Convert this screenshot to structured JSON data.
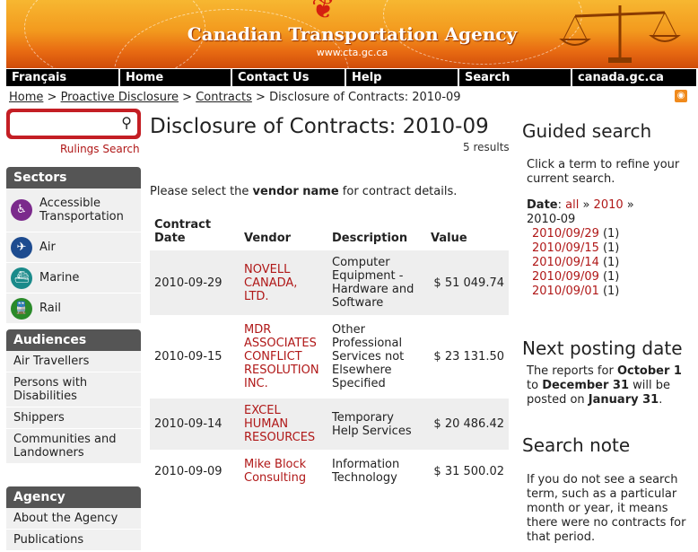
{
  "header": {
    "title": "Canadian Transportation Agency",
    "url": "www.cta.gc.ca"
  },
  "nav": [
    {
      "label": "Français",
      "w": 127
    },
    {
      "label": "Home",
      "w": 125
    },
    {
      "label": "Contact Us",
      "w": 127
    },
    {
      "label": "Help",
      "w": 126
    },
    {
      "label": "Search",
      "w": 126
    },
    {
      "label": "canada.gc.ca",
      "w": 140
    }
  ],
  "breadcrumb": {
    "home": "Home",
    "sep1": " > ",
    "proactive": "Proactive Disclosure",
    "sep2": " > ",
    "contracts": "Contracts",
    "sep3": " > ",
    "current": "Disclosure of Contracts: 2010-09"
  },
  "search": {
    "placeholder": "",
    "rulings": "Rulings Search"
  },
  "sectors": {
    "heading": "Sectors",
    "items": [
      {
        "label": "Accessible Transportation",
        "icon": "wheelchair-icon",
        "color": "#7b2a8c",
        "glyph": "♿"
      },
      {
        "label": "Air",
        "icon": "airplane-icon",
        "color": "#1d4b8f",
        "glyph": "✈"
      },
      {
        "label": "Marine",
        "icon": "ship-icon",
        "color": "#1a8a8a",
        "glyph": "⛴"
      },
      {
        "label": "Rail",
        "icon": "train-icon",
        "color": "#2a8a2a",
        "glyph": "🚆"
      }
    ]
  },
  "audiences": {
    "heading": "Audiences",
    "items": [
      "Air Travellers",
      "Persons with Disabilities",
      "Shippers",
      "Communities and Landowners"
    ]
  },
  "agency": {
    "heading": "Agency",
    "items": [
      "About the Agency",
      "Publications"
    ]
  },
  "main": {
    "title": "Disclosure of Contracts: 2010-09",
    "results": "5 results",
    "instr_pre": "Please select the ",
    "instr_bold": "vendor name",
    "instr_post": " for contract details.",
    "columns": [
      "Contract Date",
      "Vendor",
      "Description",
      "Value"
    ],
    "rows": [
      {
        "date": "2010-09-29",
        "vendor": "NOVELL CANADA, LTD.",
        "desc": "Computer Equipment - Hardware and Software",
        "value": "$ 51 049.74"
      },
      {
        "date": "2010-09-15",
        "vendor": "MDR ASSOCIATES CONFLICT RESOLUTION INC.",
        "desc": "Other Professional Services not Elsewhere Specified",
        "value": "$ 23 131.50"
      },
      {
        "date": "2010-09-14",
        "vendor": "EXCEL HUMAN RESOURCES",
        "desc": "Temporary Help Services",
        "value": "$ 20 486.42"
      },
      {
        "date": "2010-09-09",
        "vendor": "Mike Block Consulting",
        "desc": "Information Technology",
        "value": "$ 31 500.02"
      }
    ]
  },
  "guided": {
    "heading": "Guided search",
    "intro": "Click a term to refine your current search.",
    "date_label": "Date",
    "all": "all",
    "sep": " » ",
    "year": "2010",
    "month": "2010-09",
    "dates": [
      {
        "date": "2010/09/29",
        "count": "(1)"
      },
      {
        "date": "2010/09/15",
        "count": "(1)"
      },
      {
        "date": "2010/09/14",
        "count": "(1)"
      },
      {
        "date": "2010/09/09",
        "count": "(1)"
      },
      {
        "date": "2010/09/01",
        "count": "(1)"
      }
    ]
  },
  "next_posting": {
    "heading": "Next posting date",
    "t1": "The reports for ",
    "b1": "October 1",
    "t2": " to ",
    "b2": "December 31",
    "t3": " will be posted on ",
    "b3": "January 31",
    "t4": "."
  },
  "search_note": {
    "heading": "Search note",
    "text": "If you do not see a search term, such as a particular month or year, it means there were no contracts for that period."
  }
}
